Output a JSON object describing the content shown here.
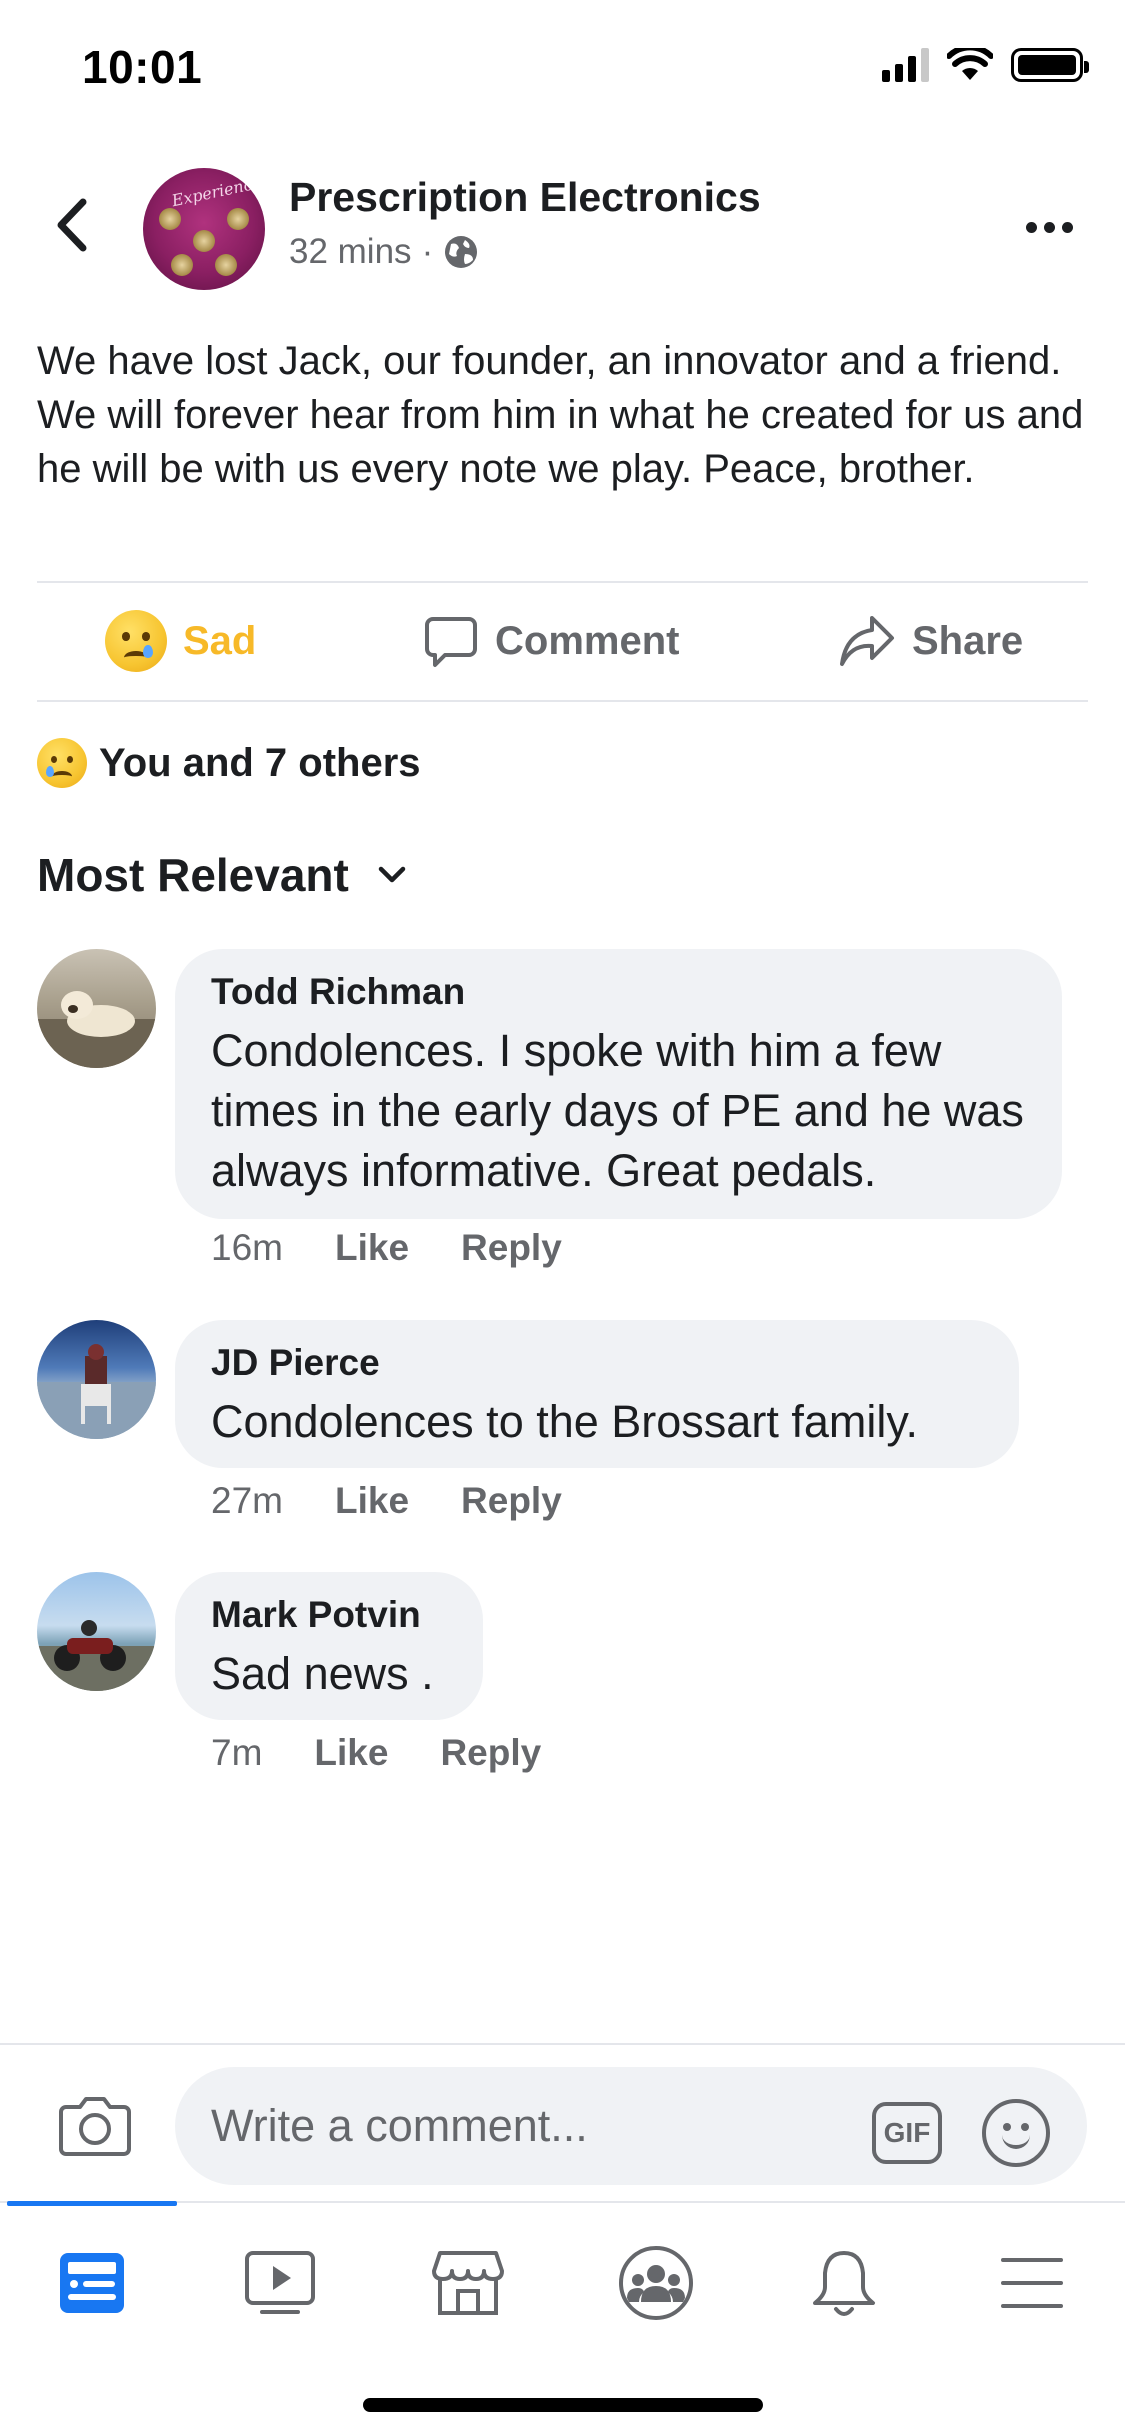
{
  "status_bar": {
    "time": "10:01"
  },
  "post": {
    "page_name": "Prescription Electronics",
    "time": "32 mins",
    "separator": "·",
    "privacy_icon": "globe-icon",
    "avatar_lettering": "Experience",
    "body": "We have lost Jack, our founder, an innovator and a friend.  We will forever hear from him in what he created for us and he will be with us every note we play.  Peace, brother."
  },
  "actions": {
    "reaction_label": "Sad",
    "comment_label": "Comment",
    "share_label": "Share",
    "reaction_color": "#f7b928"
  },
  "reactions_summary": {
    "text": "You and 7 others"
  },
  "sort": {
    "label": "Most Relevant"
  },
  "comments": [
    {
      "author": "Todd Richman",
      "text": "Condolences. I spoke with him a few times in the early days of PE and he was always informative. Great pedals.",
      "time": "16m",
      "like": "Like",
      "reply": "Reply"
    },
    {
      "author": "JD Pierce",
      "text": "Condolences to the Brossart family.",
      "time": "27m",
      "like": "Like",
      "reply": "Reply"
    },
    {
      "author": "Mark Potvin",
      "text": "Sad news .",
      "time": "7m",
      "like": "Like",
      "reply": "Reply"
    }
  ],
  "composer": {
    "placeholder": "Write a comment...",
    "gif_label": "GIF"
  },
  "tabbar": {
    "active_tab": "home",
    "accent": "#1877f2"
  },
  "colors": {
    "text": "#1c1e21",
    "secondary": "#65676b",
    "bubble": "#f0f2f5"
  }
}
